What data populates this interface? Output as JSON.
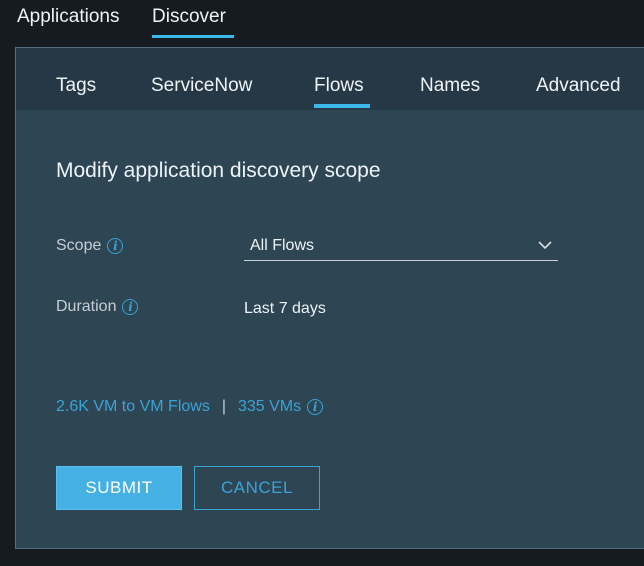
{
  "top_nav": {
    "tabs": [
      {
        "label": "Applications",
        "active": false
      },
      {
        "label": "Discover",
        "active": true
      }
    ]
  },
  "sub_tabs": [
    {
      "label": "Tags",
      "active": false
    },
    {
      "label": "ServiceNow",
      "active": false
    },
    {
      "label": "Flows",
      "active": true
    },
    {
      "label": "Names",
      "active": false
    },
    {
      "label": "Advanced",
      "active": false
    }
  ],
  "form": {
    "title": "Modify application discovery scope",
    "scope": {
      "label": "Scope",
      "value": "All Flows",
      "icon": "info-icon"
    },
    "duration": {
      "label": "Duration",
      "value": "Last 7 days",
      "icon": "info-icon"
    }
  },
  "stats": {
    "flows": "2.6K VM to VM Flows",
    "separator": "|",
    "vms": "335 VMs"
  },
  "buttons": {
    "submit": "SUBMIT",
    "cancel": "CANCEL"
  },
  "colors": {
    "accent": "#3ab8e8",
    "link": "#3aa3d6",
    "panel_bg": "#2e4553",
    "page_bg": "#151b21"
  }
}
